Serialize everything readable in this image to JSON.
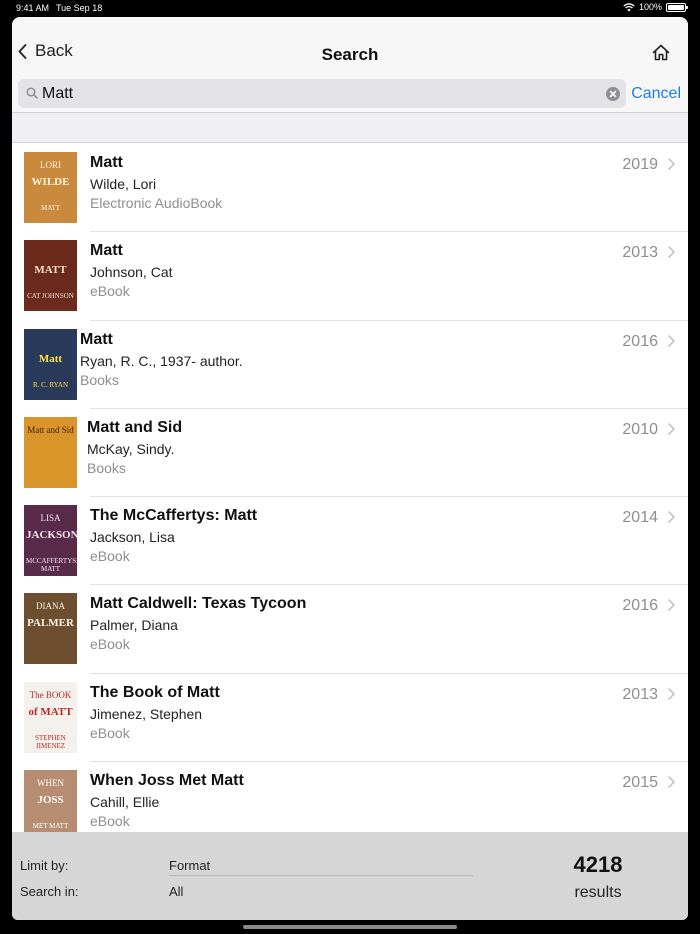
{
  "status": {
    "time": "9:41 AM",
    "date": "Tue Sep 18",
    "battery": "100%"
  },
  "nav": {
    "back_label": "Back",
    "title": "Search"
  },
  "search": {
    "value": "Matt",
    "cancel_label": "Cancel"
  },
  "results": [
    {
      "title": "Matt",
      "author": "Wilde, Lori",
      "format": "Electronic AudioBook",
      "year": "2019",
      "cover": {
        "line1": "LORI",
        "line2": "WILDE",
        "line3": "MATT",
        "bg": "#c98a3e",
        "fg": "#fff6dc"
      }
    },
    {
      "title": "Matt",
      "author": "Johnson, Cat",
      "format": "eBook",
      "year": "2013",
      "cover": {
        "line1": "",
        "line2": "MATT",
        "line3": "CAT JOHNSON",
        "bg": "#6b2a1c",
        "fg": "#f2e4d0"
      }
    },
    {
      "title": "Matt",
      "author": "Ryan, R. C., 1937- author.",
      "format": "Books",
      "year": "2016",
      "cover": {
        "line1": "",
        "line2": "Matt",
        "line3": "R. C. RYAN",
        "bg": "#2a3a5a",
        "fg": "#ffe23a"
      }
    },
    {
      "title": "Matt and Sid",
      "author": "McKay, Sindy.",
      "format": "Books",
      "year": "2010",
      "cover": {
        "line1": "Matt and Sid",
        "line2": "",
        "line3": "",
        "bg": "#d9952a",
        "fg": "#3a1d08"
      }
    },
    {
      "title": "The McCaffertys: Matt",
      "author": "Jackson, Lisa",
      "format": "eBook",
      "year": "2014",
      "cover": {
        "line1": "LISA",
        "line2": "JACKSON",
        "line3": "MCCAFFERTYS: MATT",
        "bg": "#5a2a4a",
        "fg": "#f3e7ee"
      }
    },
    {
      "title": "Matt Caldwell: Texas Tycoon",
      "author": "Palmer, Diana",
      "format": "eBook",
      "year": "2016",
      "cover": {
        "line1": "DIANA",
        "line2": "PALMER",
        "line3": "",
        "bg": "#6d4f30",
        "fg": "#fbf2e4"
      }
    },
    {
      "title": "The Book of Matt",
      "author": "Jimenez, Stephen",
      "format": "eBook",
      "year": "2013",
      "cover": {
        "line1": "The BOOK",
        "line2": "of MATT",
        "line3": "STEPHEN JIMENEZ",
        "bg": "#f4f1ec",
        "fg": "#b52a2a"
      }
    },
    {
      "title": "When Joss Met Matt",
      "author": "Cahill, Ellie",
      "format": "eBook",
      "year": "2015",
      "cover": {
        "line1": "WHEN",
        "line2": "JOSS",
        "line3": "MET MATT",
        "bg": "#b78d72",
        "fg": "#ffffff"
      }
    }
  ],
  "footer": {
    "limit_label": "Limit by:",
    "limit_value": "Format",
    "search_in_label": "Search in:",
    "search_in_value": "All",
    "count": "4218",
    "results_label": "results"
  }
}
